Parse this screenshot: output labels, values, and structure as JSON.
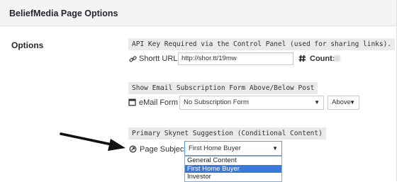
{
  "header": {
    "title": "BeliefMedia Page Options"
  },
  "section": {
    "label": "Options"
  },
  "api_note": "API Key Required via the Control Panel (used for sharing links).",
  "shorturl": {
    "label": "Shortt URL",
    "value": "http://shor.tt/19mw",
    "count_label": "Count:"
  },
  "email": {
    "note": "Show Email Subscription Form Above/Below Post",
    "label": "eMail Form",
    "form_select": "No Subscription Form",
    "position_select": "Above"
  },
  "skynet": {
    "note": "Primary Skynet Suggestion (Conditional Content)",
    "label": "Page Subject",
    "selected": "First Home Buyer",
    "options": [
      "General Content",
      "First Home Buyer",
      "Investor"
    ]
  },
  "icons": [
    "link-icon",
    "hash-icon",
    "form-icon",
    "target-icon",
    "chevron-down-icon",
    "arrow-icon"
  ]
}
